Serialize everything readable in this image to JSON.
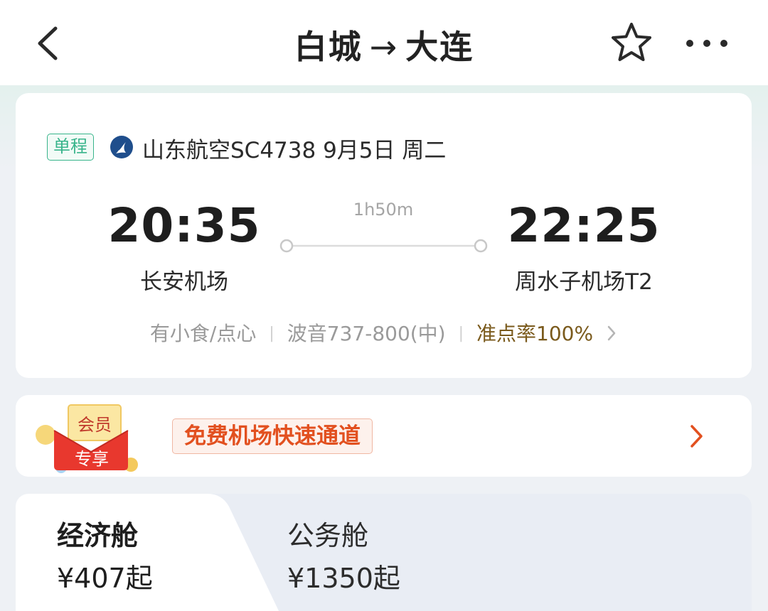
{
  "header": {
    "origin": "白城",
    "arrow": "→",
    "destination": "大连"
  },
  "flight": {
    "trip_type": "单程",
    "airline_flight": "山东航空SC4738",
    "date": "9月5日",
    "weekday": "周二",
    "departure_time": "20:35",
    "arrival_time": "22:25",
    "duration": "1h50m",
    "departure_airport": "长安机场",
    "arrival_airport": "周水子机场T2",
    "meal": "有小食/点心",
    "aircraft": "波音737-800(中)",
    "on_time_rate": "准点率100%"
  },
  "member": {
    "badge_line1": "会员",
    "badge_line2": "专享",
    "benefit": "免费机场快速通道"
  },
  "cabins": [
    {
      "name": "经济舱",
      "price": "¥407起"
    },
    {
      "name": "公务舱",
      "price": "¥1350起"
    }
  ],
  "colors": {
    "accent_green": "#38b48b",
    "promo_orange": "#e2501f",
    "on_time_gold": "#7a5a1c"
  },
  "icons": {
    "back": "chevron-left-icon",
    "favorite": "star-outline-icon",
    "more": "more-dots-icon",
    "airline": "shandong-airlines-logo",
    "info_arrow": "chevron-right-icon",
    "member_arrow": "chevron-right-icon"
  }
}
